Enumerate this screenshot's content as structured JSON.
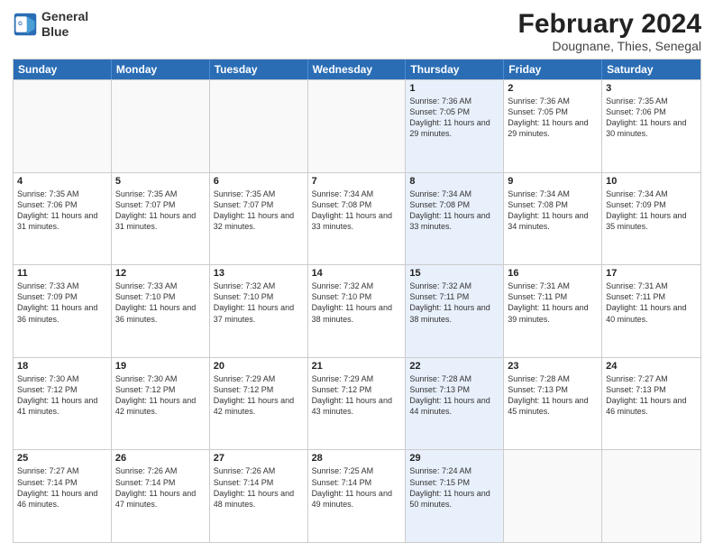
{
  "logo": {
    "line1": "General",
    "line2": "Blue"
  },
  "title": "February 2024",
  "subtitle": "Dougnane, Thies, Senegal",
  "header_days": [
    "Sunday",
    "Monday",
    "Tuesday",
    "Wednesday",
    "Thursday",
    "Friday",
    "Saturday"
  ],
  "rows": [
    [
      {
        "day": "",
        "empty": true
      },
      {
        "day": "",
        "empty": true
      },
      {
        "day": "",
        "empty": true
      },
      {
        "day": "",
        "empty": true
      },
      {
        "day": "1",
        "sunrise": "Sunrise: 7:36 AM",
        "sunset": "Sunset: 7:05 PM",
        "daylight": "Daylight: 11 hours and 29 minutes.",
        "highlight": true
      },
      {
        "day": "2",
        "sunrise": "Sunrise: 7:36 AM",
        "sunset": "Sunset: 7:05 PM",
        "daylight": "Daylight: 11 hours and 29 minutes."
      },
      {
        "day": "3",
        "sunrise": "Sunrise: 7:35 AM",
        "sunset": "Sunset: 7:06 PM",
        "daylight": "Daylight: 11 hours and 30 minutes."
      }
    ],
    [
      {
        "day": "4",
        "sunrise": "Sunrise: 7:35 AM",
        "sunset": "Sunset: 7:06 PM",
        "daylight": "Daylight: 11 hours and 31 minutes."
      },
      {
        "day": "5",
        "sunrise": "Sunrise: 7:35 AM",
        "sunset": "Sunset: 7:07 PM",
        "daylight": "Daylight: 11 hours and 31 minutes."
      },
      {
        "day": "6",
        "sunrise": "Sunrise: 7:35 AM",
        "sunset": "Sunset: 7:07 PM",
        "daylight": "Daylight: 11 hours and 32 minutes."
      },
      {
        "day": "7",
        "sunrise": "Sunrise: 7:34 AM",
        "sunset": "Sunset: 7:08 PM",
        "daylight": "Daylight: 11 hours and 33 minutes."
      },
      {
        "day": "8",
        "sunrise": "Sunrise: 7:34 AM",
        "sunset": "Sunset: 7:08 PM",
        "daylight": "Daylight: 11 hours and 33 minutes.",
        "highlight": true
      },
      {
        "day": "9",
        "sunrise": "Sunrise: 7:34 AM",
        "sunset": "Sunset: 7:08 PM",
        "daylight": "Daylight: 11 hours and 34 minutes."
      },
      {
        "day": "10",
        "sunrise": "Sunrise: 7:34 AM",
        "sunset": "Sunset: 7:09 PM",
        "daylight": "Daylight: 11 hours and 35 minutes."
      }
    ],
    [
      {
        "day": "11",
        "sunrise": "Sunrise: 7:33 AM",
        "sunset": "Sunset: 7:09 PM",
        "daylight": "Daylight: 11 hours and 36 minutes."
      },
      {
        "day": "12",
        "sunrise": "Sunrise: 7:33 AM",
        "sunset": "Sunset: 7:10 PM",
        "daylight": "Daylight: 11 hours and 36 minutes."
      },
      {
        "day": "13",
        "sunrise": "Sunrise: 7:32 AM",
        "sunset": "Sunset: 7:10 PM",
        "daylight": "Daylight: 11 hours and 37 minutes."
      },
      {
        "day": "14",
        "sunrise": "Sunrise: 7:32 AM",
        "sunset": "Sunset: 7:10 PM",
        "daylight": "Daylight: 11 hours and 38 minutes."
      },
      {
        "day": "15",
        "sunrise": "Sunrise: 7:32 AM",
        "sunset": "Sunset: 7:11 PM",
        "daylight": "Daylight: 11 hours and 38 minutes.",
        "highlight": true
      },
      {
        "day": "16",
        "sunrise": "Sunrise: 7:31 AM",
        "sunset": "Sunset: 7:11 PM",
        "daylight": "Daylight: 11 hours and 39 minutes."
      },
      {
        "day": "17",
        "sunrise": "Sunrise: 7:31 AM",
        "sunset": "Sunset: 7:11 PM",
        "daylight": "Daylight: 11 hours and 40 minutes."
      }
    ],
    [
      {
        "day": "18",
        "sunrise": "Sunrise: 7:30 AM",
        "sunset": "Sunset: 7:12 PM",
        "daylight": "Daylight: 11 hours and 41 minutes."
      },
      {
        "day": "19",
        "sunrise": "Sunrise: 7:30 AM",
        "sunset": "Sunset: 7:12 PM",
        "daylight": "Daylight: 11 hours and 42 minutes."
      },
      {
        "day": "20",
        "sunrise": "Sunrise: 7:29 AM",
        "sunset": "Sunset: 7:12 PM",
        "daylight": "Daylight: 11 hours and 42 minutes."
      },
      {
        "day": "21",
        "sunrise": "Sunrise: 7:29 AM",
        "sunset": "Sunset: 7:12 PM",
        "daylight": "Daylight: 11 hours and 43 minutes."
      },
      {
        "day": "22",
        "sunrise": "Sunrise: 7:28 AM",
        "sunset": "Sunset: 7:13 PM",
        "daylight": "Daylight: 11 hours and 44 minutes.",
        "highlight": true
      },
      {
        "day": "23",
        "sunrise": "Sunrise: 7:28 AM",
        "sunset": "Sunset: 7:13 PM",
        "daylight": "Daylight: 11 hours and 45 minutes."
      },
      {
        "day": "24",
        "sunrise": "Sunrise: 7:27 AM",
        "sunset": "Sunset: 7:13 PM",
        "daylight": "Daylight: 11 hours and 46 minutes."
      }
    ],
    [
      {
        "day": "25",
        "sunrise": "Sunrise: 7:27 AM",
        "sunset": "Sunset: 7:14 PM",
        "daylight": "Daylight: 11 hours and 46 minutes."
      },
      {
        "day": "26",
        "sunrise": "Sunrise: 7:26 AM",
        "sunset": "Sunset: 7:14 PM",
        "daylight": "Daylight: 11 hours and 47 minutes."
      },
      {
        "day": "27",
        "sunrise": "Sunrise: 7:26 AM",
        "sunset": "Sunset: 7:14 PM",
        "daylight": "Daylight: 11 hours and 48 minutes."
      },
      {
        "day": "28",
        "sunrise": "Sunrise: 7:25 AM",
        "sunset": "Sunset: 7:14 PM",
        "daylight": "Daylight: 11 hours and 49 minutes."
      },
      {
        "day": "29",
        "sunrise": "Sunrise: 7:24 AM",
        "sunset": "Sunset: 7:15 PM",
        "daylight": "Daylight: 11 hours and 50 minutes.",
        "highlight": true
      },
      {
        "day": "",
        "empty": true
      },
      {
        "day": "",
        "empty": true
      }
    ]
  ]
}
